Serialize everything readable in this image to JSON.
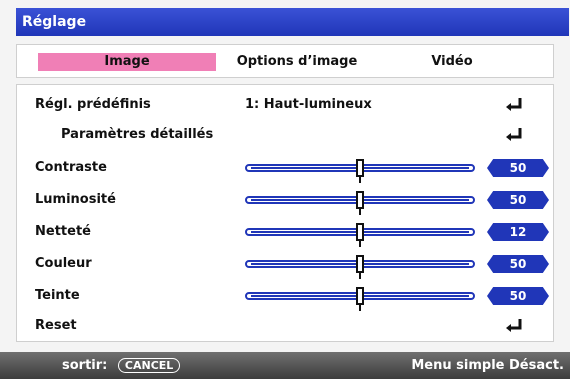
{
  "window": {
    "title": "Réglage"
  },
  "tabs": [
    {
      "label": "Image",
      "active": true
    },
    {
      "label": "Options d’image",
      "active": false
    },
    {
      "label": "Vidéo",
      "active": false
    }
  ],
  "rows": [
    {
      "label": "Régl. prédéfinis",
      "value": "1: Haut-lumineux",
      "enter_icon": "enter-arrow"
    },
    {
      "label": "Paramètres détaillés",
      "enter_icon": "enter-arrow"
    },
    {
      "label": "Contraste",
      "slider_value": 50,
      "slider_fraction": 0.5
    },
    {
      "label": "Luminosité",
      "slider_value": 50,
      "slider_fraction": 0.5
    },
    {
      "label": "Netteté",
      "slider_value": 12,
      "slider_fraction": 0.5
    },
    {
      "label": "Couleur",
      "slider_value": 50,
      "slider_fraction": 0.5
    },
    {
      "label": "Teinte",
      "slider_value": 50,
      "slider_fraction": 0.5
    },
    {
      "label": "Reset",
      "enter_icon": "enter-arrow"
    }
  ],
  "footer": {
    "exit_label": "sortir:",
    "cancel_key": "CANCEL",
    "simple_menu_label": "Menu simple Désact."
  },
  "colors": {
    "title_bar": "#2036b8",
    "active_tab": "#f07fb6",
    "slider_badge": "#2036b8",
    "footer_bar": "#4a4a4a"
  }
}
